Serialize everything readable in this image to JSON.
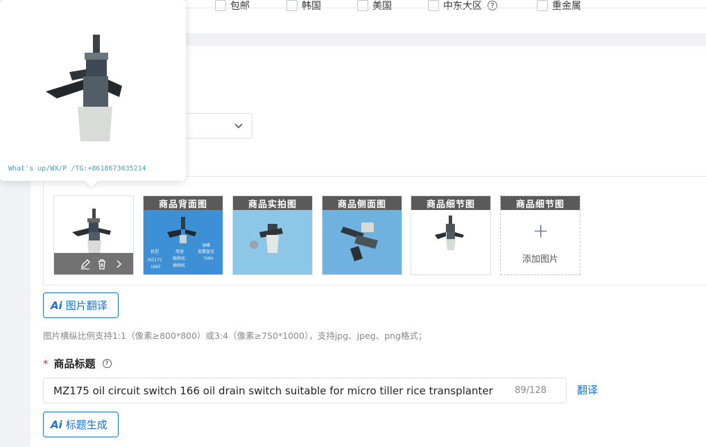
{
  "filters": {
    "checkboxes": [
      "包邮",
      "韩国",
      "美国",
      "中东大区",
      "重金属"
    ]
  },
  "images": {
    "popover_watermark": "What's up/WX/P /TG:+8618673035214",
    "thumbnails": [
      {
        "caption": "",
        "kind": "main"
      },
      {
        "caption": "商品背面图",
        "kind": "back",
        "overlay": [
          "机型",
          "用途",
          "油嘴",
          "MZ175",
          "微耕机",
          "宽螺直径",
          "186F",
          "插秧机",
          "7MM"
        ]
      },
      {
        "caption": "商品实拍图",
        "kind": "real"
      },
      {
        "caption": "商品侧面图",
        "kind": "side"
      },
      {
        "caption": "商品细节图",
        "kind": "detail"
      },
      {
        "caption": "商品细节图",
        "kind": "add"
      }
    ],
    "add_label": "添加图片",
    "translate_button": "图片翻译",
    "ai_badge": "Ai",
    "hint": "图片横纵比例支持1:1（像素≥800*800）或3:4（像素≥750*1000），支持jpg、jpeg、png格式；"
  },
  "title_field": {
    "required_mark": "*",
    "label": "商品标题",
    "help_icon": "?",
    "value": "MZ175 oil circuit switch 166 oil drain switch suitable for micro tiller rice transplanter",
    "counter": "89/128",
    "translate_link": "翻译",
    "generate_button": "标题生成"
  },
  "colors": {
    "accent": "#1f6fd6",
    "required": "#e22233"
  }
}
